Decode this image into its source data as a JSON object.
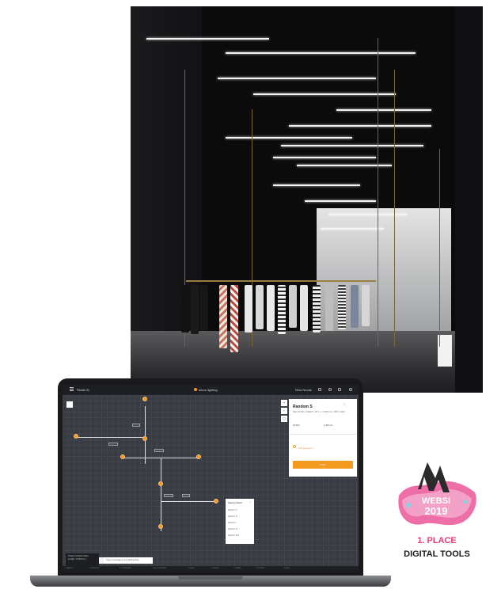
{
  "app": {
    "project_label": "Retail-01",
    "brand": "arkos lighting",
    "user_label": "Nina Novak"
  },
  "panel": {
    "title": "Random S",
    "subtitle": "DALI 10 W/m | 3000 K | 20° | L = 2 800 mm • IP20 • black",
    "value_left": "24 W/m",
    "value_right": "1 400 mm",
    "add_label": "Add accessory",
    "button_label": "Order"
  },
  "dropdown": {
    "header": "Select product",
    "close": "×",
    "options": [
      "Random S",
      "Random M",
      "Random L",
      "Random XL",
      "Random XXL"
    ]
  },
  "toolbox": {
    "line1": "Project: Fashion Store",
    "line2": "Length: 12 540 mm",
    "chat_placeholder": "Type a message to our lighting team"
  },
  "bottombar": {
    "items": [
      "1 ARKOS",
      "2 PRODUCT",
      "3 CONFIGURE",
      "4 ACCESSORIES",
      "5 CABLE",
      "6 ORDER",
      "7 SHARE",
      "8 CONTACT",
      "9 HELP"
    ]
  },
  "award": {
    "badge_name": "WEBSI",
    "badge_year": "2019",
    "place": "1. PLACE",
    "category": "DIGITAL TOOLS"
  },
  "colors": {
    "accent": "#f39a1f",
    "screen_bg": "#34363d",
    "award_pink": "#e43d77"
  }
}
